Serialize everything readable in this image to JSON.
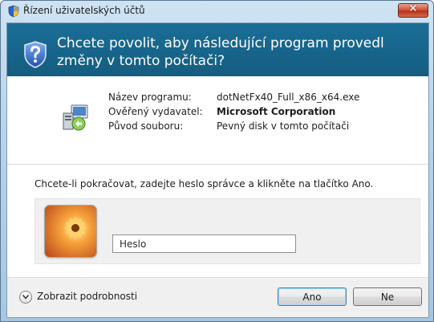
{
  "window": {
    "title": "Řízení uživatelských účtů",
    "close_glyph": "×"
  },
  "banner": {
    "question": "Chcete povolit, aby následující program provedl změny v tomto počítači?",
    "icon": "uac-shield-icon"
  },
  "details": {
    "icon": "program-installer-icon",
    "rows": [
      {
        "label": "Název programu:",
        "value": "dotNetFx40_Full_x86_x64.exe",
        "bold": false
      },
      {
        "label": "Ověřený vydavatel:",
        "value": "Microsoft Corporation",
        "bold": true
      },
      {
        "label": "Původ souboru:",
        "value": "Pevný disk v tomto počítači",
        "bold": false
      }
    ]
  },
  "instruction": "Chcete-li pokračovat, zadejte heslo správce a klikněte na tlačítko Ano.",
  "credentials": {
    "username": "",
    "password_placeholder": "Heslo",
    "password_value": ""
  },
  "footer": {
    "details_toggle_label": "Zobrazit podrobnosti",
    "yes_label": "Ano",
    "no_label": "Ne"
  },
  "colors": {
    "banner": "#1a6e97",
    "close_button": "#c8472d",
    "default_button_border": "#3c7fb1"
  }
}
